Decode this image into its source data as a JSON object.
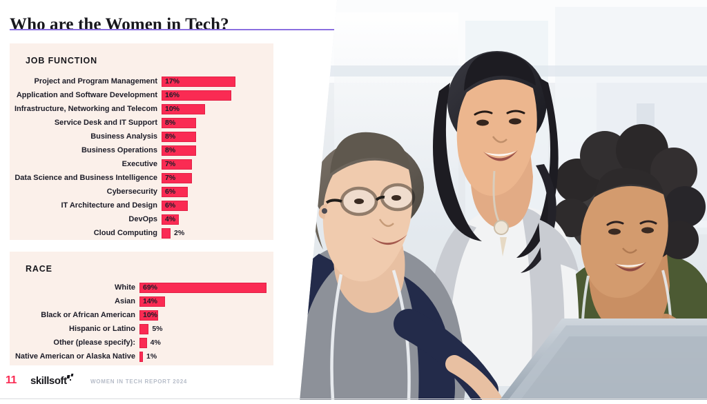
{
  "title": "Who are the Women in Tech?",
  "colors": {
    "bar": "#fa2b53",
    "bar_border": "#e21f45",
    "panel_bg": "#fbf0ea",
    "rule": "#8a6ee0",
    "label": "#1c1c28",
    "footer_muted": "#b6bcc8"
  },
  "footer": {
    "page_number": "11",
    "logo": "skillsoft",
    "report": "WOMEN IN TECH REPORT 2024"
  },
  "photo": {
    "alt": "Three women collaborating around a laptop in a bright modern office"
  },
  "chart_data": [
    {
      "type": "bar",
      "orientation": "horizontal",
      "title": "JOB FUNCTION",
      "xlabel": "",
      "ylabel": "",
      "unit": "%",
      "grid": false,
      "legend": "none",
      "xlim": [
        0,
        20
      ],
      "categories": [
        "Project and Program Management",
        "Application and Software Development",
        "Infrastructure, Networking and Telecom",
        "Service Desk and IT Support",
        "Business Analysis",
        "Business Operations",
        "Executive",
        "Data Science and Business Intelligence",
        "Cybersecurity",
        "IT Architecture and Design",
        "DevOps",
        "Cloud Computing"
      ],
      "values": [
        17,
        16,
        10,
        8,
        8,
        8,
        7,
        7,
        6,
        6,
        4,
        2
      ],
      "value_labels": [
        "17%",
        "16%",
        "10%",
        "8%",
        "8%",
        "8%",
        "7%",
        "7%",
        "6%",
        "6%",
        "4%",
        "2%"
      ],
      "label_placement": [
        "in",
        "in",
        "in",
        "in",
        "in",
        "in",
        "in",
        "in",
        "in",
        "in",
        "in",
        "out"
      ]
    },
    {
      "type": "bar",
      "orientation": "horizontal",
      "title": "RACE",
      "xlabel": "",
      "ylabel": "",
      "unit": "%",
      "grid": false,
      "legend": "none",
      "xlim": [
        0,
        72
      ],
      "categories": [
        "White",
        "Asian",
        "Black or African American",
        "Hispanic or Latino",
        "Other (please specify):",
        "Native American or Alaska Native"
      ],
      "values": [
        69,
        14,
        10,
        5,
        4,
        1
      ],
      "value_labels": [
        "69%",
        "14%",
        "10%",
        "5%",
        "4%",
        "1%"
      ],
      "label_placement": [
        "in",
        "in",
        "in",
        "out",
        "out",
        "out"
      ]
    }
  ]
}
